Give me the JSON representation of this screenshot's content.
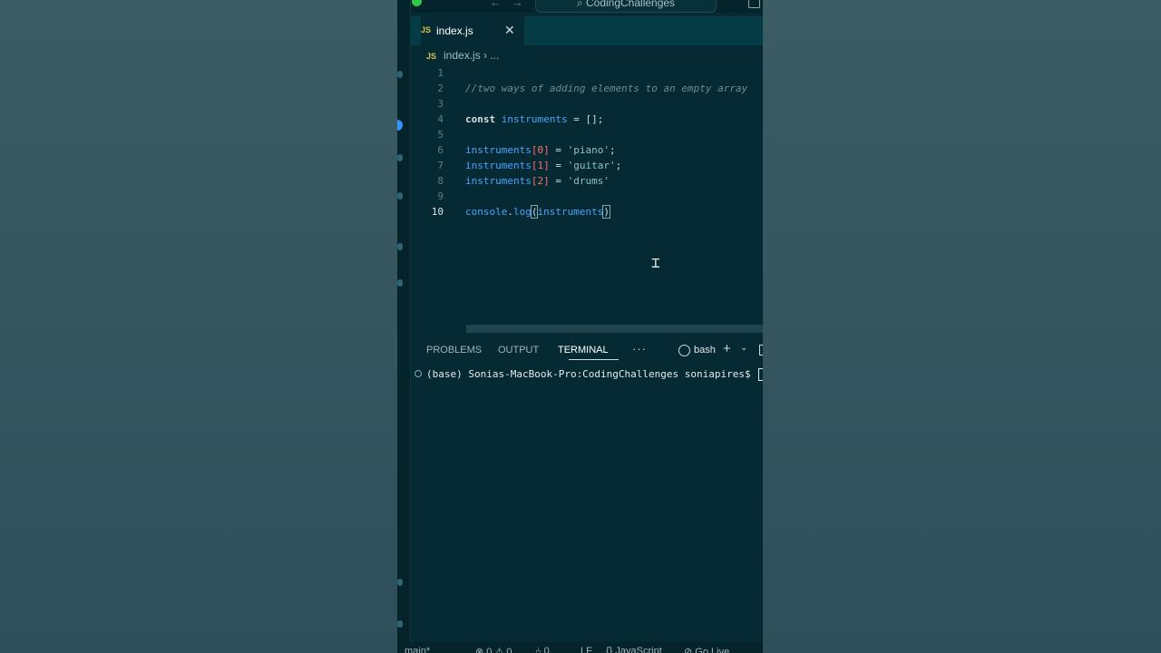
{
  "titlebar": {
    "search": "CodingChallenges"
  },
  "tab": {
    "icon": "JS",
    "label": "index.js",
    "close": "✕"
  },
  "breadcrumb": {
    "icon": "JS",
    "file": "index.js",
    "sep": "›",
    "more": "..."
  },
  "editor": {
    "line_numbers": [
      "1",
      "2",
      "3",
      "4",
      "5",
      "6",
      "7",
      "8",
      "9",
      "10"
    ],
    "comment": "//two ways of adding elements to an empty array",
    "l4": {
      "kw": "const",
      "var": "instruments",
      "eq": " = ",
      "rest": "[];"
    },
    "l6": {
      "var": "instruments",
      "open": "[",
      "idx": "0",
      "close": "]",
      "eq": " = ",
      "str": "'piano'",
      "end": ";"
    },
    "l7": {
      "var": "instruments",
      "open": "[",
      "idx": "1",
      "close": "]",
      "eq": " = ",
      "str": "'guitar'",
      "end": ";"
    },
    "l8": {
      "var": "instruments",
      "open": "[",
      "idx": "2",
      "close": "]",
      "eq": " = ",
      "str": "'drums'"
    },
    "l10": {
      "obj": "console",
      "dot": ".",
      "fn": "log",
      "open": "(",
      "arg": "instruments",
      "close": ")"
    }
  },
  "panel": {
    "tabs": [
      "PROBLEMS",
      "OUTPUT",
      "TERMINAL"
    ],
    "more": "···",
    "shell": "bash"
  },
  "terminal": {
    "prompt": "(base) Sonias-MacBook-Pro:CodingChallenges soniapires$ "
  },
  "statusbar": {
    "branch": "main*",
    "errors": "⊗ 0 ⚠ 0",
    "ports": "⑃ 0",
    "eol": "LF",
    "lang": "{} JavaScript",
    "golive": "⊘ Go Live"
  }
}
